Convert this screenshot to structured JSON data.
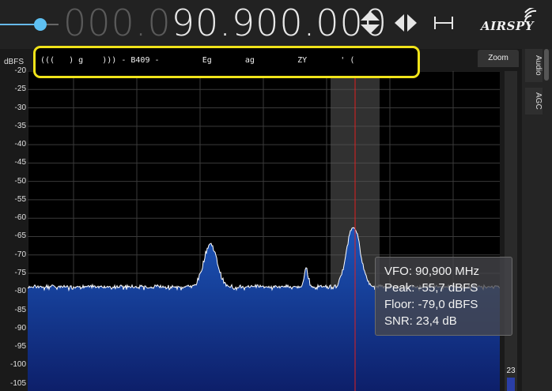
{
  "frequency": {
    "dim_part": "000.0",
    "lit_part": "90.900.000"
  },
  "logo": {
    "text": "AIRSPY"
  },
  "spectrum": {
    "unit": "dBFS",
    "y_ticks": [
      "-20",
      "-25",
      "-30",
      "-35",
      "-40",
      "-45",
      "-50",
      "-55",
      "-60",
      "-65",
      "-70",
      "-75",
      "-80",
      "-85",
      "-90",
      "-95",
      "-100",
      "-105"
    ],
    "ylim": [
      -107,
      -20
    ],
    "noise_floor_db": -79,
    "peaks": [
      {
        "x_frac": 0.387,
        "db": -67,
        "width": 0.03
      },
      {
        "x_frac": 0.59,
        "db": -74,
        "width": 0.01
      },
      {
        "x_frac": 0.69,
        "db": -62,
        "width": 0.03
      }
    ],
    "colors": {
      "fill": "#1c55b8",
      "fill_deep": "#0d1f6a",
      "trace": "#ffffff",
      "grid": "#3a3a3a",
      "vfo_line": "#e02020",
      "bandwidth": "#3a3a3a"
    }
  },
  "rds": {
    "text": "(((   ) g    ))) - B409 -         Eg       ag         ZY       ' ("
  },
  "zoom": {
    "label": "Zoom",
    "value": "23"
  },
  "side_tabs": {
    "audio": "Audio",
    "agc": "AGC"
  },
  "tooltip": {
    "vfo": "VFO:  90,900 MHz",
    "peak": "Peak: -55,7 dBFS",
    "floor": "Floor: -79,0 dBFS",
    "snr": "SNR:  23,4 dB"
  }
}
